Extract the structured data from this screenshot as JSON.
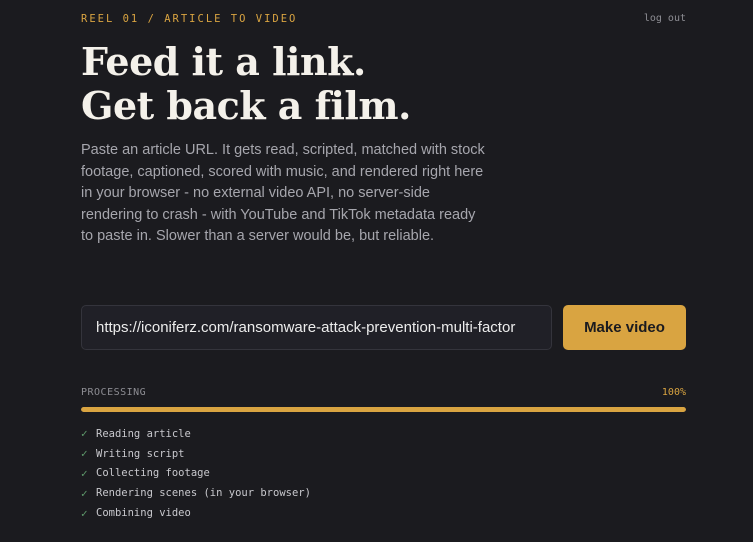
{
  "header": {
    "eyebrow": "REEL 01 / ARTICLE TO VIDEO",
    "logout_label": "log out"
  },
  "hero": {
    "title_line1": "Feed it a link.",
    "title_line2": "Get back a film.",
    "description": "Paste an article URL. It gets read, scripted, matched with stock footage, captioned, scored with music, and rendered right here in your browser - no external video API, no server-side rendering to crash - with YouTube and TikTok metadata ready to paste in. Slower than a server would be, but reliable."
  },
  "form": {
    "url_value": "https://iconiferz.com/ransomware-attack-prevention-multi-factor",
    "submit_label": "Make video"
  },
  "progress": {
    "label": "PROCESSING",
    "percent_label": "100%",
    "percent": 100,
    "steps": [
      {
        "icon": "check-icon",
        "glyph": "✓",
        "label": "Reading article"
      },
      {
        "icon": "check-icon",
        "glyph": "✓",
        "label": "Writing script"
      },
      {
        "icon": "check-icon",
        "glyph": "✓",
        "label": "Collecting footage"
      },
      {
        "icon": "check-icon",
        "glyph": "✓",
        "label": "Rendering scenes (in your browser)"
      },
      {
        "icon": "check-icon",
        "glyph": "✓",
        "label": "Combining video"
      }
    ]
  },
  "colors": {
    "background": "#1b1b1f",
    "accent": "#d9a441",
    "success": "#5f9a6c"
  }
}
